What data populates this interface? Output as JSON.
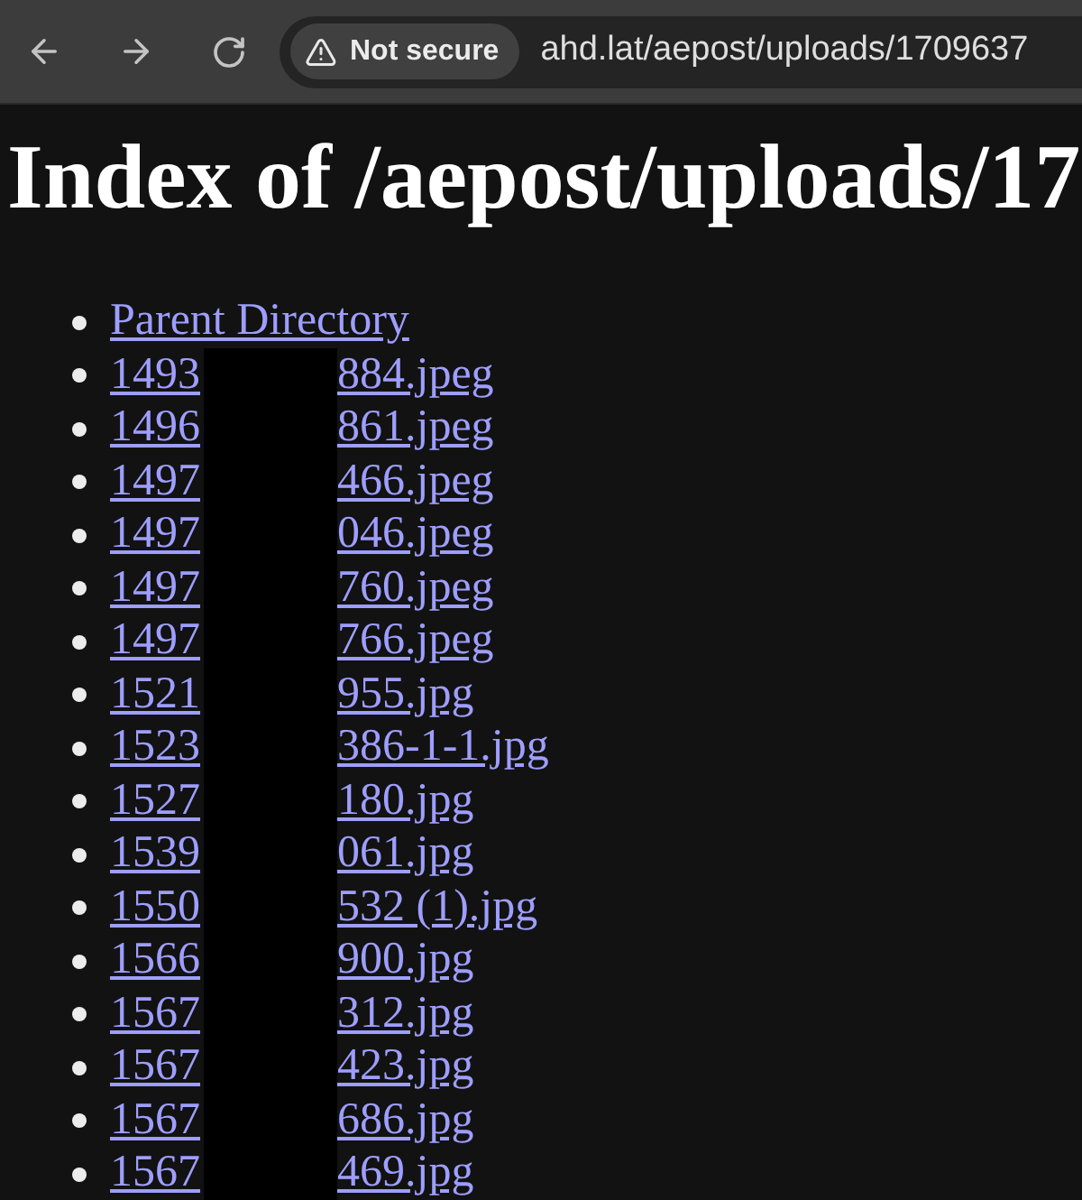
{
  "browser": {
    "security_label": "Not secure",
    "url": "ahd.lat/aepost/uploads/1709637"
  },
  "page": {
    "heading": "Index of /aepost/uploads/17",
    "redacted": true,
    "entries": [
      {
        "kind": "parent",
        "label": "Parent Directory"
      },
      {
        "kind": "file",
        "name_start": "1493",
        "name_end": "884.jpeg"
      },
      {
        "kind": "file",
        "name_start": "1496",
        "name_end": "861.jpeg"
      },
      {
        "kind": "file",
        "name_start": "1497",
        "name_end": "466.jpeg"
      },
      {
        "kind": "file",
        "name_start": "1497",
        "name_end": "046.jpeg"
      },
      {
        "kind": "file",
        "name_start": "1497",
        "name_end": "760.jpeg"
      },
      {
        "kind": "file",
        "name_start": "1497",
        "name_end": "766.jpeg"
      },
      {
        "kind": "file",
        "name_start": "1521",
        "name_end": "955.jpg"
      },
      {
        "kind": "file",
        "name_start": "1523",
        "name_end": "386-1-1.jpg"
      },
      {
        "kind": "file",
        "name_start": "1527",
        "name_end": "180.jpg"
      },
      {
        "kind": "file",
        "name_start": "1539",
        "name_end": "061.jpg"
      },
      {
        "kind": "file",
        "name_start": "1550",
        "name_end": "532 (1).jpg"
      },
      {
        "kind": "file",
        "name_start": "1566",
        "name_end": "900.jpg"
      },
      {
        "kind": "file",
        "name_start": "1567",
        "name_end": "312.jpg"
      },
      {
        "kind": "file",
        "name_start": "1567",
        "name_end": "423.jpg"
      },
      {
        "kind": "file",
        "name_start": "1567",
        "name_end": "686.jpg"
      },
      {
        "kind": "file",
        "name_start": "1567",
        "name_end": "469.jpg"
      }
    ]
  }
}
